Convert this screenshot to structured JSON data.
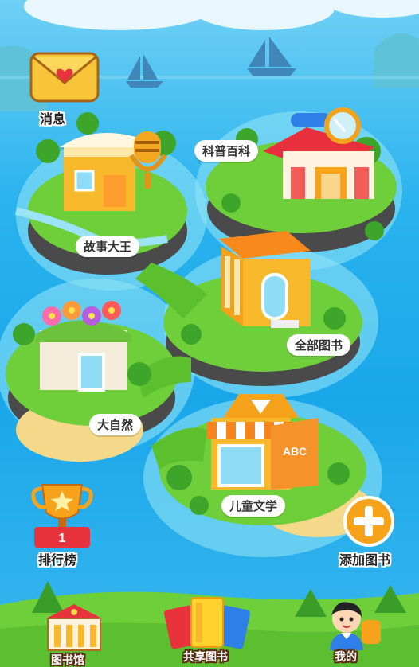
{
  "messages": {
    "label": "消息",
    "icon": "envelope-heart-icon"
  },
  "map": {
    "islands": [
      {
        "id": "science",
        "label": "科普百科",
        "icon": "observatory-building-icon"
      },
      {
        "id": "stories",
        "label": "故事大王",
        "icon": "microphone-house-icon"
      },
      {
        "id": "all",
        "label": "全部图书",
        "icon": "library-building-icon"
      },
      {
        "id": "nature",
        "label": "大自然",
        "icon": "flower-house-icon"
      },
      {
        "id": "children",
        "label": "儿童文学",
        "icon": "abc-shop-icon"
      }
    ],
    "abc_sign": "ABC"
  },
  "ranking": {
    "label": "排行榜",
    "icon": "trophy-icon",
    "podium_number": "1"
  },
  "add_book": {
    "label": "添加图书",
    "icon": "plus-icon"
  },
  "bottom_nav": {
    "items": [
      {
        "id": "library",
        "label": "图书馆",
        "icon": "library-icon"
      },
      {
        "id": "shared",
        "label": "共享图书",
        "icon": "books-icon"
      },
      {
        "id": "mine",
        "label": "我的",
        "icon": "avatar-icon"
      }
    ]
  },
  "colors": {
    "sea": "#1aa7ea",
    "grass": "#6fcf3a",
    "accent_orange": "#f7a21b",
    "label_bg": "#ffffff"
  }
}
